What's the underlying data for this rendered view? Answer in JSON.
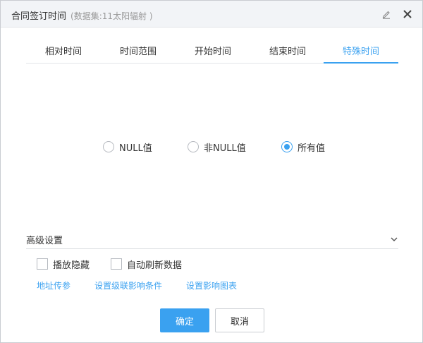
{
  "dialog": {
    "title": "合同签订时间",
    "subtitle": "(数据集:11太阳辐射 )",
    "icons": {
      "edit": "pencil-icon",
      "close": "close-icon"
    }
  },
  "tabs": [
    {
      "label": "相对时间",
      "active": false
    },
    {
      "label": "时间范围",
      "active": false
    },
    {
      "label": "开始时间",
      "active": false
    },
    {
      "label": "结束时间",
      "active": false
    },
    {
      "label": "特殊时间",
      "active": true
    }
  ],
  "radio_options": [
    {
      "label": "NULL值",
      "checked": false
    },
    {
      "label": "非NULL值",
      "checked": false
    },
    {
      "label": "所有值",
      "checked": true
    }
  ],
  "advanced": {
    "label": "高级设置",
    "icon": "chevron-down-icon",
    "checkboxes": [
      {
        "label": "播放隐藏",
        "checked": false
      },
      {
        "label": "自动刷新数据",
        "checked": false
      }
    ],
    "links": [
      "地址传参",
      "设置级联影响条件",
      "设置影响图表"
    ]
  },
  "buttons": {
    "ok": "确定",
    "cancel": "取消"
  },
  "colors": {
    "accent": "#3aa1f0",
    "header_bg": "#f2f4f7",
    "border": "#c9ccd1"
  }
}
